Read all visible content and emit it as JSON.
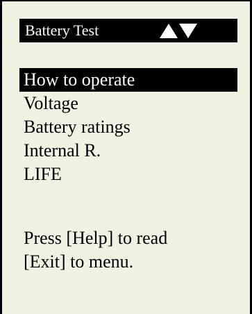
{
  "header": {
    "title": "Battery Test",
    "arrows": [
      "up-arrow-icon",
      "down-arrow-icon"
    ]
  },
  "menu": {
    "items": [
      {
        "label": "How to operate",
        "selected": true
      },
      {
        "label": "Voltage",
        "selected": false
      },
      {
        "label": "Battery ratings",
        "selected": false
      },
      {
        "label": "Internal R.",
        "selected": false
      },
      {
        "label": "LIFE",
        "selected": false
      }
    ]
  },
  "help": {
    "line1": "Press [Help] to read",
    "line2": "[Exit] to menu."
  },
  "colors": {
    "screen_background": "#eef3e2",
    "highlight": "#000000",
    "text": "#000000"
  }
}
